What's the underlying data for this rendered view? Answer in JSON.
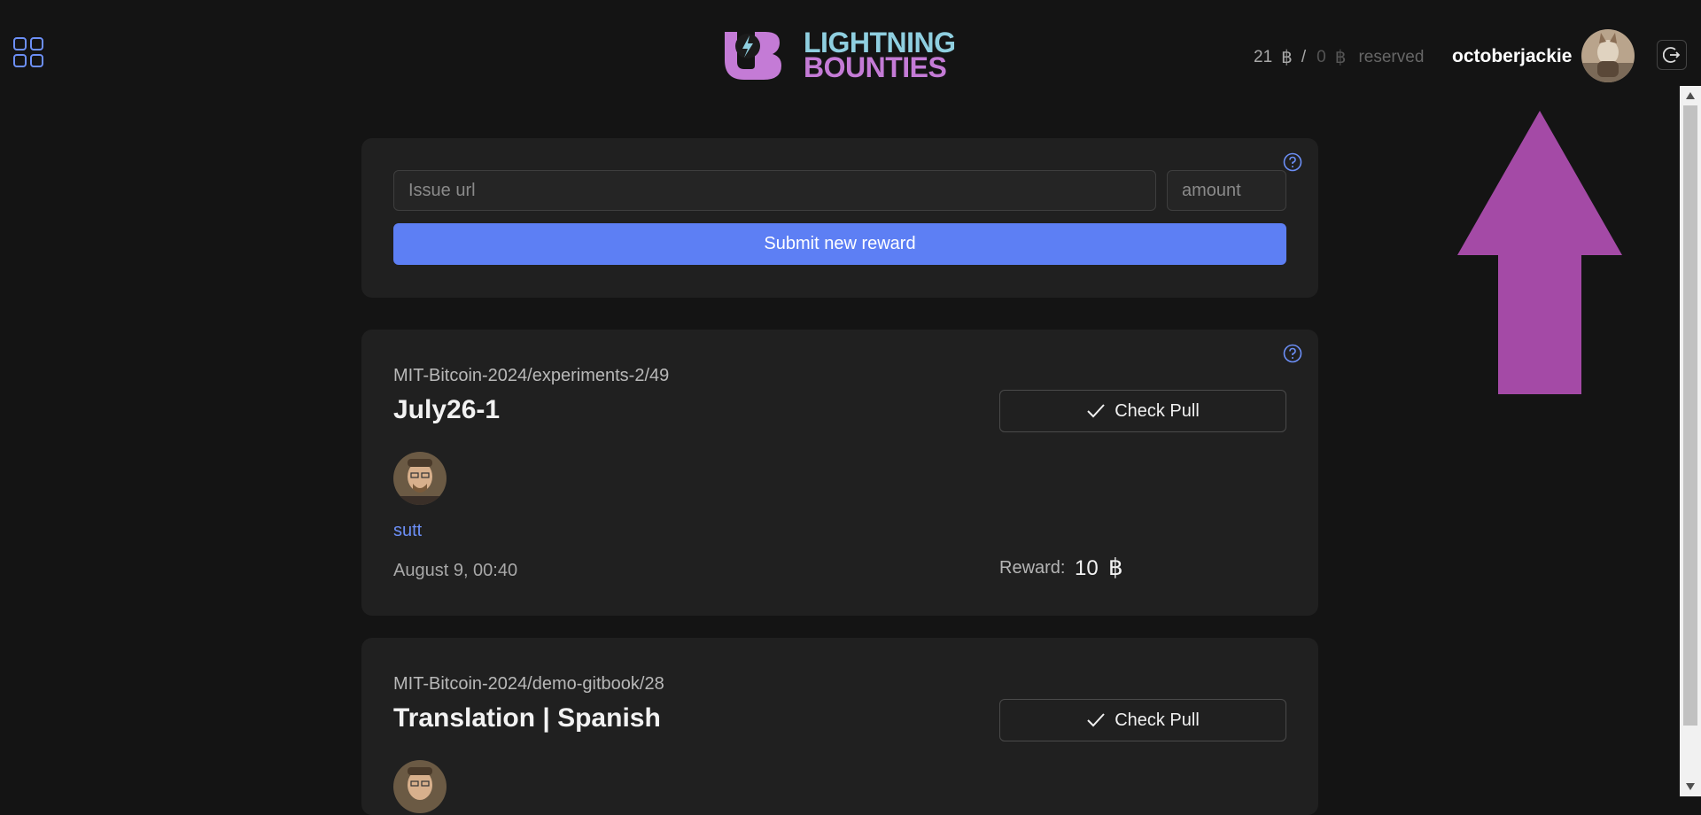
{
  "header": {
    "logo_initials": "UB",
    "logo_line1": "LIGHTNING",
    "logo_line2": "BOUNTIES",
    "balance_available": "21",
    "balance_separator": "/",
    "balance_reserved": "0",
    "reserved_label": "reserved",
    "username": "octoberjackie",
    "sat_symbol": "฿"
  },
  "new_reward": {
    "issue_placeholder": "Issue url",
    "amount_placeholder": "amount",
    "submit_label": "Submit new reward"
  },
  "bounties": [
    {
      "repo": "MIT-Bitcoin-2024/experiments-2/49",
      "title": "July26-1",
      "check_label": "Check Pull",
      "user": "sutt",
      "date": "August 9, 00:40",
      "reward_label": "Reward:",
      "reward_value": "10"
    },
    {
      "repo": "MIT-Bitcoin-2024/demo-gitbook/28",
      "title": "Translation | Spanish",
      "check_label": "Check Pull"
    }
  ],
  "colors": {
    "background": "#141414",
    "card": "#202020",
    "accent": "#5d7ff4",
    "link": "#6c8ff6",
    "annotation_arrow": "#a44aa6"
  },
  "icons": {
    "menu": "grid-menu-icon",
    "help": "question-circle-icon",
    "check": "check-icon",
    "logout": "logout-icon",
    "sat": "satoshi-icon"
  }
}
